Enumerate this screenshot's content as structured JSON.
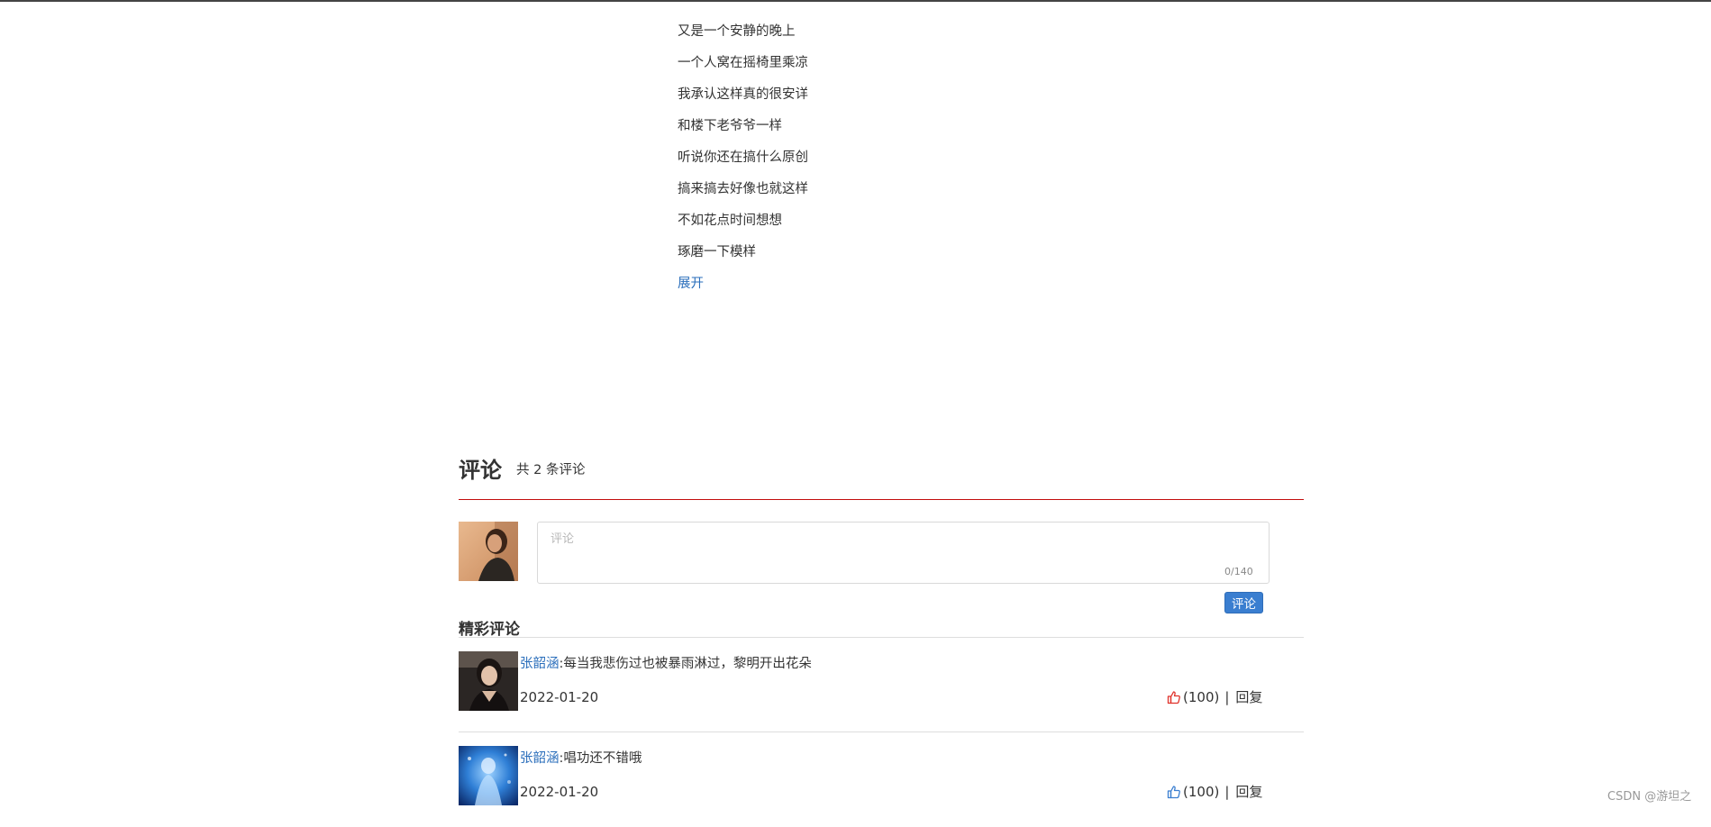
{
  "lyrics": {
    "lines": [
      "又是一个安静的晚上",
      "一个人窝在摇椅里乘凉",
      "我承认这样真的很安详",
      "和楼下老爷爷一样",
      "听说你还在搞什么原创",
      "搞来搞去好像也就这样",
      "不如花点时间想想",
      "琢磨一下模样"
    ],
    "expand_label": "展开"
  },
  "comments": {
    "title": "评论",
    "count_text": "共 2 条评论",
    "composer": {
      "placeholder": "评论",
      "char_count": "0/140",
      "submit_label": "评论"
    },
    "featured_title": "精彩评论",
    "items": [
      {
        "user": "张韶涵",
        "text": ":每当我悲伤过也被暴雨淋过，黎明开出花朵",
        "date": "2022-01-20",
        "likes": "(100)",
        "separator": "|",
        "reply_label": "回复",
        "like_color": "#e0322b"
      },
      {
        "user": "张韶涵",
        "text": ":唱功还不错哦",
        "date": "2022-01-20",
        "likes": "(100)",
        "separator": "|",
        "reply_label": "回复",
        "like_color": "#3a7ed0"
      }
    ]
  },
  "watermark": "CSDN @游坦之",
  "colors": {
    "accent_red": "#c20c0c",
    "link_blue": "#2a6ebb",
    "button_blue": "#3a7ed0"
  }
}
